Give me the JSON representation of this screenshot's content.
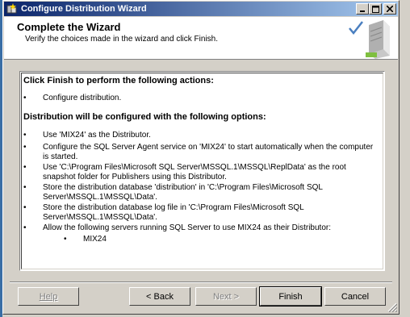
{
  "window": {
    "title": "Configure Distribution Wizard",
    "controls": {
      "minimize": "_",
      "maximize": "□",
      "close": "×"
    }
  },
  "header": {
    "title": "Complete the Wizard",
    "subtitle": "Verify the choices made in the wizard and click Finish."
  },
  "summary": {
    "actions_heading": "Click Finish to perform the following actions:",
    "actions": [
      "Configure distribution."
    ],
    "options_heading": "Distribution will be configured with the following options:",
    "options": [
      "Use 'MIX24' as the Distributor.",
      "Configure the SQL Server Agent service on 'MIX24' to start automatically when the computer is started.",
      "Use 'C:\\Program Files\\Microsoft SQL Server\\MSSQL.1\\MSSQL\\ReplData' as the root snapshot folder for Publishers using this Distributor.",
      "Store the distribution database 'distribution' in 'C:\\Program Files\\Microsoft SQL Server\\MSSQL.1\\MSSQL\\Data'.",
      "Store the distribution database log file in 'C:\\Program Files\\Microsoft SQL Server\\MSSQL.1\\MSSQL\\Data'.",
      "Allow the following servers running SQL Server to use MIX24 as their Distributor:"
    ],
    "servers": [
      "MIX24"
    ],
    "bullet_char": "•"
  },
  "buttons": {
    "help": "Help",
    "back": "< Back",
    "next": "Next >",
    "finish": "Finish",
    "cancel": "Cancel"
  }
}
